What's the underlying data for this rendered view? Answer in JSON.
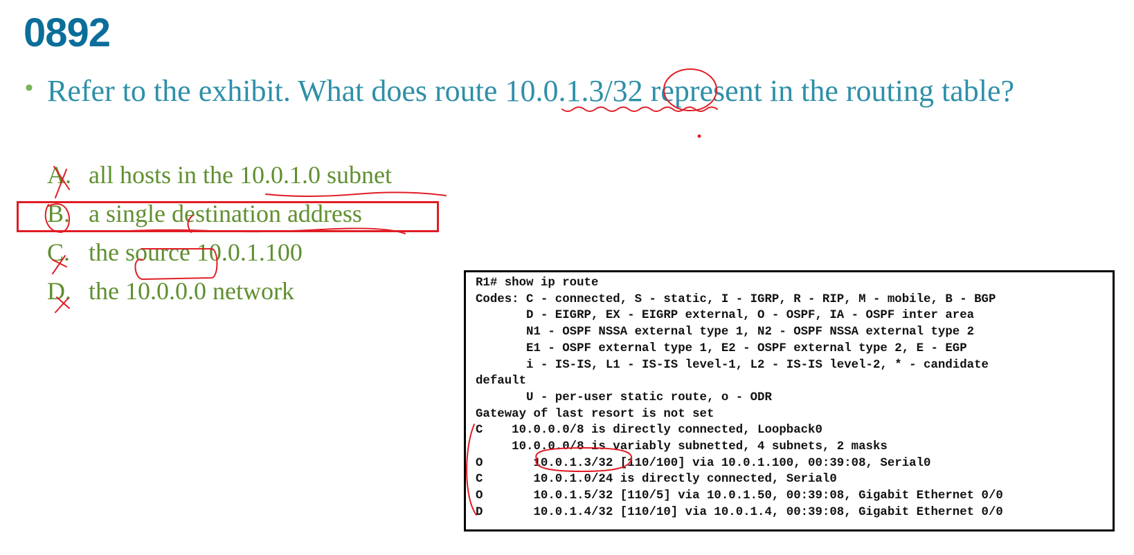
{
  "title": "0892",
  "bullet": "•",
  "question": "Refer to the exhibit. What does route 10.0.1.3/32 represent in the routing table?",
  "options": [
    {
      "letter": "A.",
      "text": "all hosts in the 10.0.1.0 subnet"
    },
    {
      "letter": "B.",
      "text": "a single destination address"
    },
    {
      "letter": "C.",
      "text": "the source 10.0.1.100"
    },
    {
      "letter": "D.",
      "text": "the 10.0.0.0 network"
    }
  ],
  "exhibit": {
    "lines": [
      "R1# show ip route",
      "Codes: C - connected, S - static, I - IGRP, R - RIP, M - mobile, B - BGP",
      "       D - EIGRP, EX - EIGRP external, O - OSPF, IA - OSPF inter area",
      "       N1 - OSPF NSSA external type 1, N2 - OSPF NSSA external type 2",
      "       E1 - OSPF external type 1, E2 - OSPF external type 2, E - EGP",
      "       i - IS-IS, L1 - IS-IS level-1, L2 - IS-IS level-2, * - candidate",
      "default",
      "       U - per-user static route, o - ODR",
      "Gateway of last resort is not set",
      "C    10.0.0.0/8 is directly connected, Loopback0",
      "     10.0.0.0/8 is variably subnetted, 4 subnets, 2 masks",
      "O       10.0.1.3/32 [110/100] via 10.0.1.100, 00:39:08, Serial0",
      "C       10.0.1.0/24 is directly connected, Serial0",
      "O       10.0.1.5/32 [110/5] via 10.0.1.50, 00:39:08, Gigabit Ethernet 0/0",
      "D       10.0.1.4/32 [110/10] via 10.0.1.4, 00:39:08, Gigabit Ethernet 0/0"
    ]
  },
  "colors": {
    "title": "#0b6e9a",
    "question": "#2e8fa8",
    "options": "#5f8f2f",
    "annotation": "#e01c24"
  }
}
